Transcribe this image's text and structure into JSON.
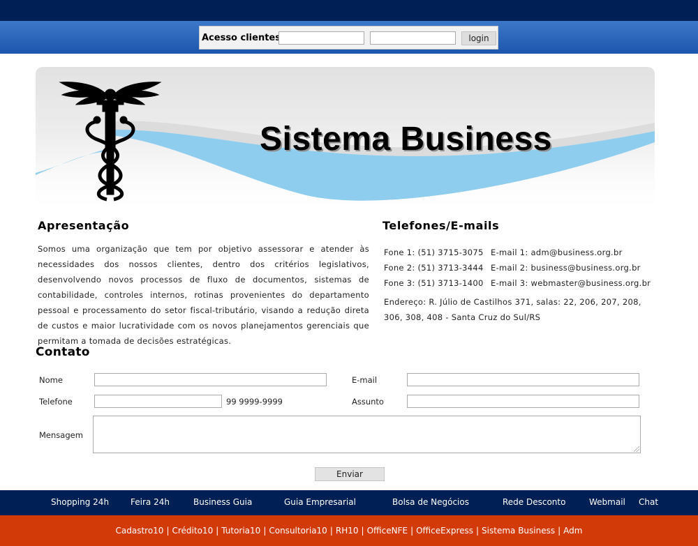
{
  "login": {
    "label": "Acesso clientes:",
    "user_value": "",
    "password_value": "",
    "button": "login"
  },
  "banner": {
    "title": "Sistema Business",
    "logo_icon": "caduceus-icon"
  },
  "apresentacao": {
    "heading": "Apresentação",
    "text": "Somos uma organização que tem por objetivo assessorar e atender às necessidades dos nossos clientes, dentro dos critérios legislativos, desenvolvendo novos processos de fluxo de documentos, sistemas de contabilidade, controles internos, rotinas provenientes do departamento pessoal e processamento do setor fiscal-tributário, visando a redução direta de custos e maior lucratividade com os novos planejamentos gerenciais que permitam a tomada de decisões estratégicas."
  },
  "telefones": {
    "heading": "Telefones/E-mails",
    "rows": [
      {
        "phone": "Fone 1: (51) 3715-3075",
        "email": "E-mail 1: adm@business.org.br"
      },
      {
        "phone": "Fone 2: (51) 3713-3444",
        "email": "E-mail 2: business@business.org.br"
      },
      {
        "phone": "Fone 3: (51) 3713-1400",
        "email": "E-mail 3: webmaster@business.org.br"
      }
    ],
    "address": "Endereço: R. Júlio de Castilhos 371, salas: 22, 206, 207, 208, 306, 308, 408 - Santa Cruz do Sul/RS"
  },
  "contato": {
    "heading": "Contato",
    "nome_label": "Nome",
    "nome_value": "",
    "email_label": "E-mail",
    "email_value": "",
    "telefone_label": "Telefone",
    "telefone_value": "",
    "telefone_hint": "99 9999-9999",
    "assunto_label": "Assunto",
    "assunto_value": "",
    "mensagem_label": "Mensagem",
    "mensagem_value": "",
    "submit": "Enviar"
  },
  "nav": {
    "items": [
      "Shopping 24h",
      "Feira 24h",
      "Business Guia",
      "Guia Empresarial",
      "Bolsa de Negócios",
      "Rede Desconto",
      "Webmail",
      "Chat"
    ]
  },
  "footer": {
    "links": [
      "Cadastro10",
      "Crédito10",
      "Tutoria10",
      "Consultoria10",
      "RH10",
      "OfficeNFE",
      "OfficeExpress",
      "Sistema Business",
      "Adm"
    ],
    "separator": "|"
  },
  "colors": {
    "top_bar": "#001f55",
    "login_bar": "#2a64b8",
    "footer_bar": "#d23a08",
    "banner_swoosh": "#8fcdef"
  }
}
